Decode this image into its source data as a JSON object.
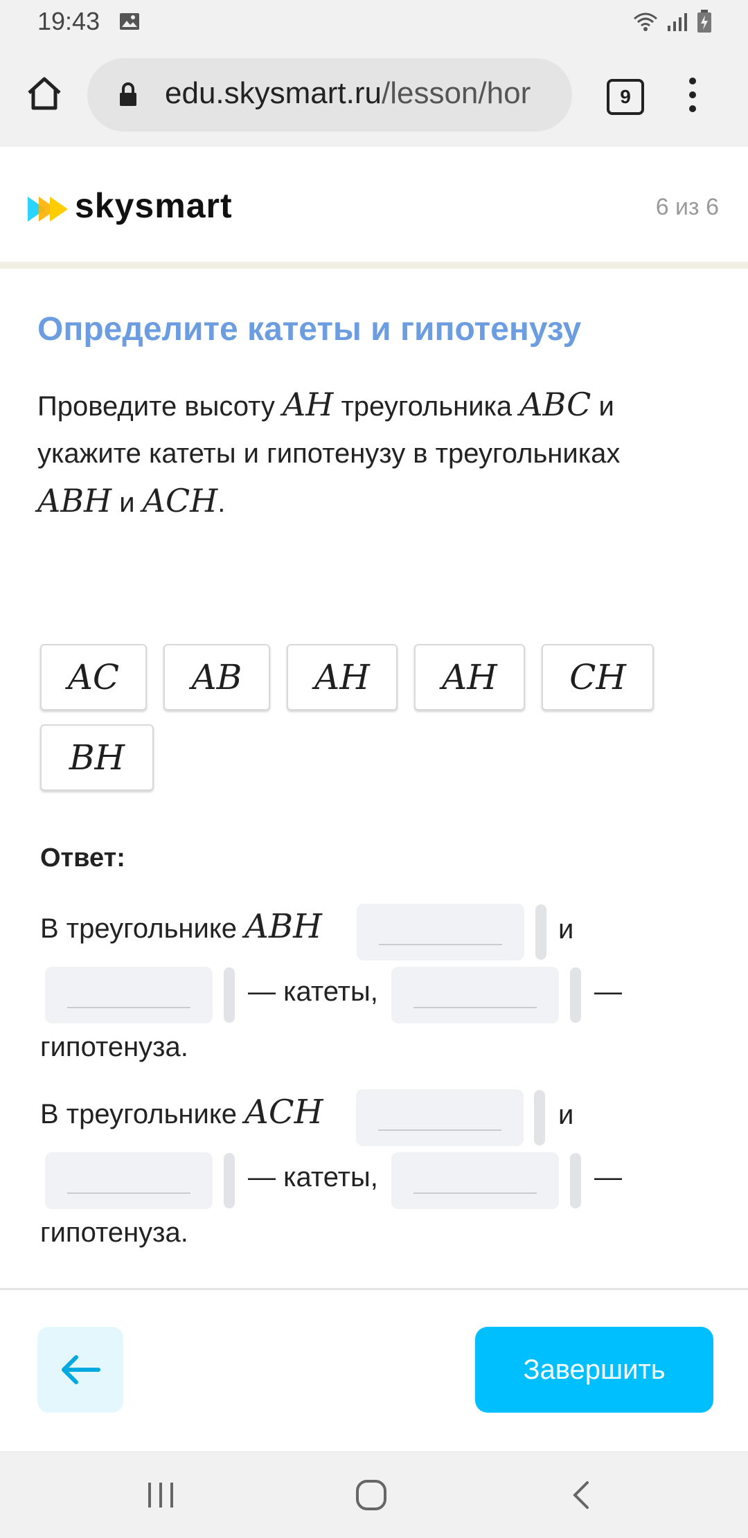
{
  "status_bar": {
    "time": "19:43"
  },
  "browser": {
    "url_main": "edu.skysmart.ru",
    "url_path": "/lesson/hor",
    "tab_count": "9"
  },
  "header": {
    "logo_text": "skysmart",
    "progress": "6 из 6"
  },
  "task": {
    "title": "Определите катеты и гипотенузу",
    "text_1": "Проведите высоту ",
    "math_1": "AH",
    "text_2": " треугольника ",
    "math_2": "ABC",
    "text_3": " и",
    "text_4": "укажите катеты и гипотенузу в треугольниках",
    "math_3": "ABH",
    "text_5": " и ",
    "math_4": "ACH",
    "text_6": "."
  },
  "chips": [
    "AC",
    "AB",
    "AH",
    "AH",
    "CH",
    "BH"
  ],
  "answer": {
    "label": "Ответ:",
    "line_prefix": "В треугольнике",
    "tri1": "ABH",
    "tri2": "ACH",
    "and": "и",
    "legs": "— катеты,",
    "dash": "—",
    "hypotenuse": "гипотенуза."
  },
  "footer": {
    "finish_label": "Завершить"
  },
  "colors": {
    "accent": "#00bfff",
    "title": "#6b9de0",
    "back_bg": "#e4f7fd"
  },
  "icons": [
    "image-icon",
    "wifi-icon",
    "signal-icon",
    "battery-icon",
    "home-icon",
    "lock-icon",
    "menu-icon",
    "back-arrow-icon",
    "recent-apps-icon",
    "home-nav-icon",
    "back-nav-icon"
  ]
}
